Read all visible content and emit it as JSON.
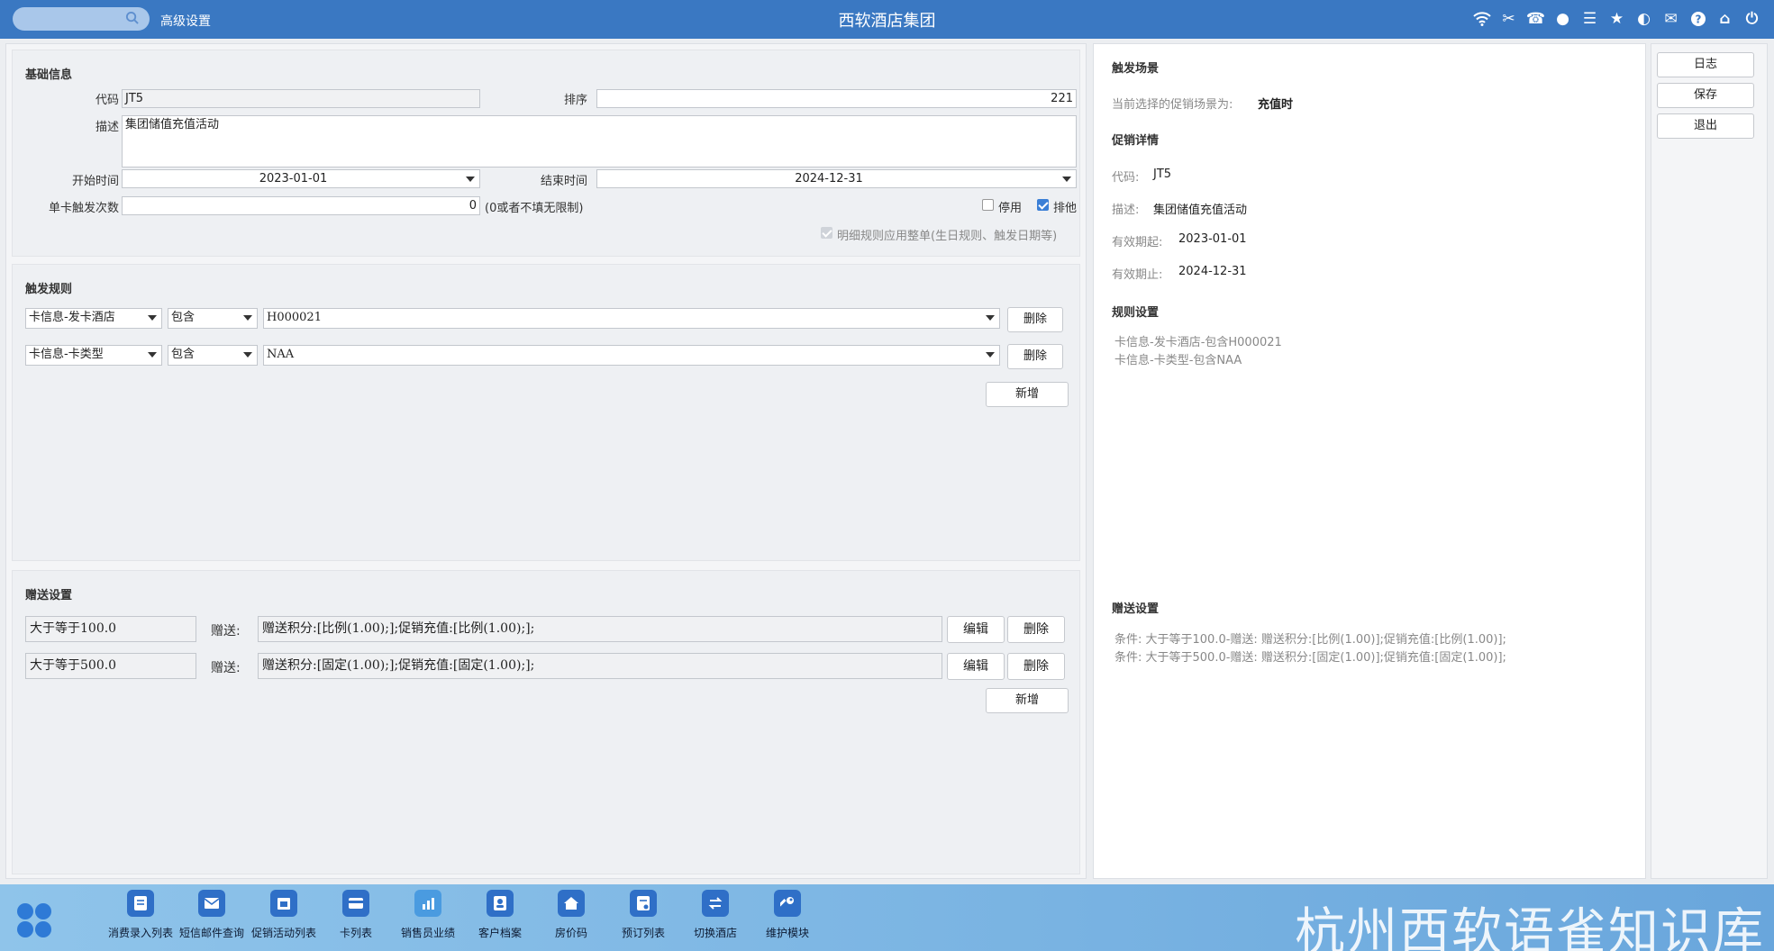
{
  "topbar": {
    "search_placeholder": "",
    "advanced_label": "高级设置",
    "title": "西软酒店集团",
    "icons": [
      "wifi-icon",
      "tools-icon",
      "phone-icon",
      "palette-icon",
      "menu-icon",
      "star-icon",
      "moon-icon",
      "mail-icon",
      "help-icon",
      "home-icon",
      "power-icon"
    ]
  },
  "basic": {
    "section_title": "基础信息",
    "code_label": "代码",
    "code_value": "JT5",
    "sort_label": "排序",
    "sort_value": "221",
    "desc_label": "描述",
    "desc_value": "集团储值充值活动",
    "start_label": "开始时间",
    "start_value": "2023-01-01",
    "end_label": "结束时间",
    "end_value": "2024-12-31",
    "count_label": "单卡触发次数",
    "count_value": "0",
    "count_hint": "(0或者不填无限制)",
    "disable_label": "停用",
    "disable_checked": false,
    "exclusive_label": "排他",
    "exclusive_checked": true,
    "detail_rule_label": "明细规则应用整单(生日规则、触发日期等)",
    "detail_rule_checked": true
  },
  "trigger": {
    "section_title": "触发规则",
    "rules": [
      {
        "field": "卡信息-发卡酒店",
        "op": "包含",
        "value": "H000021",
        "delete": "删除"
      },
      {
        "field": "卡信息-卡类型",
        "op": "包含",
        "value": "NAA",
        "delete": "删除"
      }
    ],
    "add_label": "新增"
  },
  "gift": {
    "section_title": "赠送设置",
    "give_label": "赠送:",
    "rows": [
      {
        "condition": "大于等于100.0",
        "detail": "赠送积分:[比例(1.00);];促销充值:[比例(1.00);];",
        "edit": "编辑",
        "delete": "删除"
      },
      {
        "condition": "大于等于500.0",
        "detail": "赠送积分:[固定(1.00);];促销充值:[固定(1.00);];",
        "edit": "编辑",
        "delete": "删除"
      }
    ],
    "add_label": "新增"
  },
  "summary": {
    "scene_title": "触发场景",
    "scene_text": "当前选择的促销场景为:",
    "scene_value": "充值时",
    "detail_title": "促销详情",
    "code_key": "代码:",
    "code_val": "JT5",
    "desc_key": "描述:",
    "desc_val": "集团储值充值活动",
    "start_key": "有效期起:",
    "start_val": "2023-01-01",
    "end_key": "有效期止:",
    "end_val": "2024-12-31",
    "rules_title": "规则设置",
    "rules": [
      "卡信息-发卡酒店-包含H000021",
      "卡信息-卡类型-包含NAA"
    ],
    "gift_title": "赠送设置",
    "gifts": [
      "条件: 大于等于100.0-赠送: 赠送积分:[比例(1.00)];促销充值:[比例(1.00)];",
      "条件: 大于等于500.0-赠送: 赠送积分:[固定(1.00)];促销充值:[固定(1.00)];"
    ]
  },
  "side": {
    "log": "日志",
    "save": "保存",
    "exit": "退出"
  },
  "bottom_nav": [
    {
      "label": "消费录入列表",
      "icon": "note-icon"
    },
    {
      "label": "短信邮件查询",
      "icon": "mail-icon"
    },
    {
      "label": "促销活动列表",
      "icon": "calendar-icon"
    },
    {
      "label": "卡列表",
      "icon": "card-icon"
    },
    {
      "label": "销售员业绩",
      "icon": "chart-icon"
    },
    {
      "label": "客户档案",
      "icon": "profile-icon"
    },
    {
      "label": "房价码",
      "icon": "house-icon"
    },
    {
      "label": "预订列表",
      "icon": "booking-icon"
    },
    {
      "label": "切换酒店",
      "icon": "switch-icon"
    },
    {
      "label": "维护模块",
      "icon": "wrench-icon"
    }
  ],
  "watermark": "杭州西软语雀知识库",
  "colors": {
    "topbar": "#3a78c2",
    "accent": "#3b7fd6",
    "bottom": "#79b3e2"
  }
}
